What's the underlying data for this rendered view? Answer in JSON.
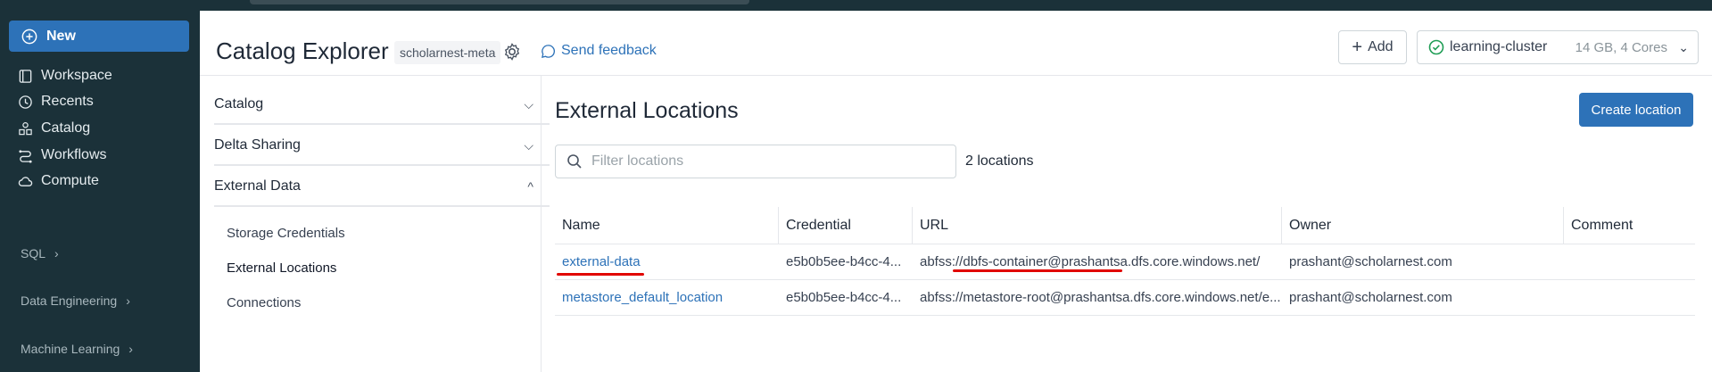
{
  "sidebar": {
    "new_label": "New",
    "items": [
      {
        "label": "Workspace",
        "icon": "workspace-icon"
      },
      {
        "label": "Recents",
        "icon": "clock-icon"
      },
      {
        "label": "Catalog",
        "icon": "catalog-icon"
      },
      {
        "label": "Workflows",
        "icon": "workflows-icon"
      },
      {
        "label": "Compute",
        "icon": "cloud-icon"
      }
    ],
    "sections": [
      {
        "label": "SQL"
      },
      {
        "label": "Data Engineering"
      },
      {
        "label": "Machine Learning"
      }
    ]
  },
  "header": {
    "title": "Catalog Explorer",
    "metastore": "scholarnest-meta",
    "feedback": "Send feedback",
    "add_label": "Add",
    "cluster_name": "learning-cluster",
    "cluster_spec": "14 GB, 4 Cores"
  },
  "nav": {
    "accordions": [
      {
        "label": "Catalog",
        "expanded": false
      },
      {
        "label": "Delta Sharing",
        "expanded": false
      },
      {
        "label": "External Data",
        "expanded": true
      }
    ],
    "sub_items": [
      "Storage Credentials",
      "External Locations",
      "Connections"
    ]
  },
  "content": {
    "title": "External Locations",
    "create_label": "Create location",
    "filter_placeholder": "Filter locations",
    "count": "2 locations",
    "columns": [
      "Name",
      "Credential",
      "URL",
      "Owner",
      "Comment"
    ],
    "rows": [
      {
        "name": "external-data",
        "credential": "e5b0b5ee-b4cc-4...",
        "url": "abfss://dbfs-container@prashantsa.dfs.core.windows.net/",
        "owner": "prashant@scholarnest.com",
        "comment": ""
      },
      {
        "name": "metastore_default_location",
        "credential": "e5b0b5ee-b4cc-4...",
        "url": "abfss://metastore-root@prashantsa.dfs.core.windows.net/e...",
        "owner": "prashant@scholarnest.com",
        "comment": ""
      }
    ]
  },
  "colors": {
    "sidebar_bg": "#1b3139",
    "accent": "#2d72b8",
    "annotation_red": "#e10600"
  }
}
